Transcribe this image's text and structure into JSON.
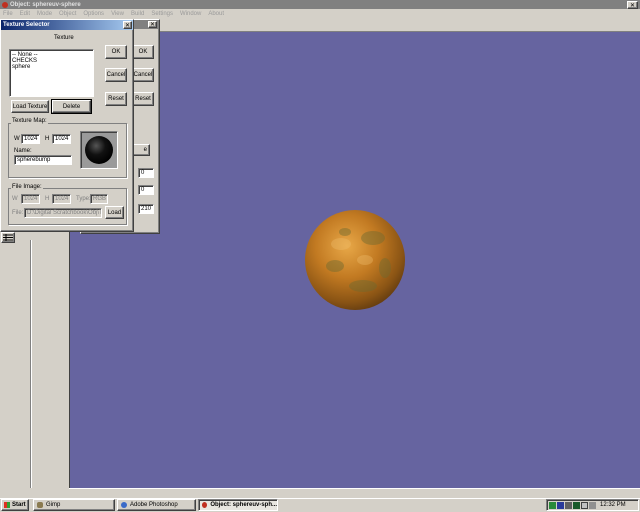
{
  "app": {
    "title": "Object: sphereuv-sphere",
    "menu": [
      "File",
      "Edit",
      "Mode",
      "Object",
      "Options",
      "View",
      "Build",
      "Settings",
      "Window",
      "About"
    ]
  },
  "colors": {
    "viewport": "#6664a0",
    "titlebar_active": "#0a246a",
    "titlebar_inactive": "#808080",
    "desktop_panel": "#d4d0c8"
  },
  "back_dialog": {
    "ok_label": "OK",
    "cancel_label": "Cancel",
    "reset_label": "Reset",
    "partial_button": "e",
    "values": [
      "0",
      "0",
      "210"
    ],
    "value_labels": [
      "l",
      "",
      ""
    ]
  },
  "texture_selector": {
    "title": "Texture Selector",
    "group_label": "Texture",
    "textures": [
      "-- None --",
      "CHECKS",
      "sphere"
    ],
    "ok_label": "OK",
    "cancel_label": "Cancel",
    "reset_label": "Reset",
    "load_texture_label": "Load Texture",
    "delete_label": "Delete",
    "texture_map": {
      "label": "Texture Map:",
      "w_label": "W",
      "w_value": "1024",
      "h_label": "H",
      "h_value": "1024",
      "name_label": "Name:",
      "name_value": "spherebump"
    },
    "file_image": {
      "label": "File Image:",
      "w_label": "W",
      "w_value": "1024",
      "h_label": "H",
      "h_value": "1024",
      "type_label": "Type:",
      "type_value": "RGB",
      "file_label": "File:",
      "file_value": "D:\\Digital Scratchbook\\Obj\\Txtr",
      "load_label": "Load"
    }
  },
  "taskbar": {
    "start_label": "Start",
    "tasks": [
      "Gimp",
      "Adobe Photoshop",
      "Object: sphereuv-sph..."
    ],
    "clock": "12:32 PM"
  }
}
